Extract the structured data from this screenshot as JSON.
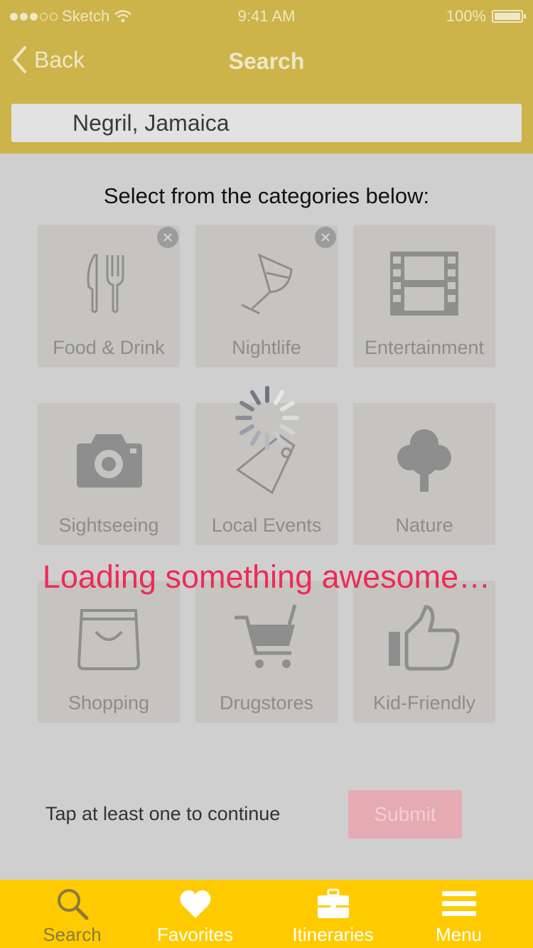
{
  "status": {
    "carrier": "Sketch",
    "time": "9:41 AM",
    "battery": "100%"
  },
  "nav": {
    "back_label": "Back",
    "title": "Search"
  },
  "search": {
    "value": "Negril, Jamaica"
  },
  "prompt": "Select from the categories below:",
  "categories": [
    {
      "label": "Food & Drink",
      "icon": "fork-knife-icon",
      "selected": true
    },
    {
      "label": "Nightlife",
      "icon": "wine-glass-icon",
      "selected": true
    },
    {
      "label": "Entertainment",
      "icon": "film-icon",
      "selected": false
    },
    {
      "label": "Sightseeing",
      "icon": "camera-icon",
      "selected": false
    },
    {
      "label": "Local Events",
      "icon": "tag-icon",
      "selected": false
    },
    {
      "label": "Nature",
      "icon": "tree-icon",
      "selected": false
    },
    {
      "label": "Shopping",
      "icon": "shopping-bag-icon",
      "selected": false
    },
    {
      "label": "Drugstores",
      "icon": "cart-icon",
      "selected": false
    },
    {
      "label": "Kid-Friendly",
      "icon": "thumbs-up-icon",
      "selected": false
    }
  ],
  "loading": {
    "text": "Loading something awesome…"
  },
  "footer": {
    "hint": "Tap at least one to continue",
    "submit_label": "Submit"
  },
  "tabs": [
    {
      "label": "Search",
      "icon": "search-icon",
      "active": true
    },
    {
      "label": "Favorites",
      "icon": "heart-icon",
      "active": false
    },
    {
      "label": "Itineraries",
      "icon": "briefcase-icon",
      "active": false
    },
    {
      "label": "Menu",
      "icon": "menu-icon",
      "active": false
    }
  ],
  "colors": {
    "header": "#ccb44a",
    "tabbar": "#ffcb00",
    "loading": "#ef2a56",
    "submit": "#e6aab2"
  }
}
